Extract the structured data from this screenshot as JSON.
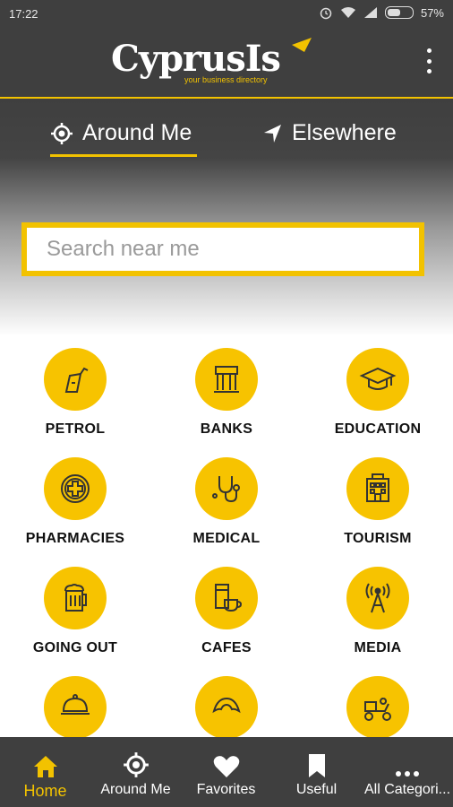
{
  "status": {
    "time": "17:22",
    "battery": "57%"
  },
  "header": {
    "logo_main": "CyprusIs",
    "tagline": "your business directory"
  },
  "tabs": [
    {
      "label": "Around Me"
    },
    {
      "label": "Elsewhere"
    }
  ],
  "search": {
    "placeholder": "Search near me"
  },
  "categories": [
    {
      "label": "PETROL",
      "icon": "fuel-pump-icon"
    },
    {
      "label": "BANKS",
      "icon": "bank-icon"
    },
    {
      "label": "EDUCATION",
      "icon": "graduation-cap-icon"
    },
    {
      "label": "PHARMACIES",
      "icon": "pharmacy-cross-icon"
    },
    {
      "label": "MEDICAL",
      "icon": "stethoscope-icon"
    },
    {
      "label": "TOURISM",
      "icon": "hotel-icon"
    },
    {
      "label": "GOING OUT",
      "icon": "beer-mug-icon"
    },
    {
      "label": "CAFES",
      "icon": "coffee-cup-icon"
    },
    {
      "label": "MEDIA",
      "icon": "antenna-icon"
    },
    {
      "label": "",
      "icon": "food-cloche-icon"
    },
    {
      "label": "",
      "icon": "croissant-icon"
    },
    {
      "label": "",
      "icon": "delivery-scooter-icon"
    }
  ],
  "nav": [
    {
      "label": "Home"
    },
    {
      "label": "Around Me"
    },
    {
      "label": "Favorites"
    },
    {
      "label": "Useful"
    },
    {
      "label": "All Categori..."
    }
  ],
  "colors": {
    "accent": "#f2c200",
    "bar": "#3f3f3f"
  }
}
